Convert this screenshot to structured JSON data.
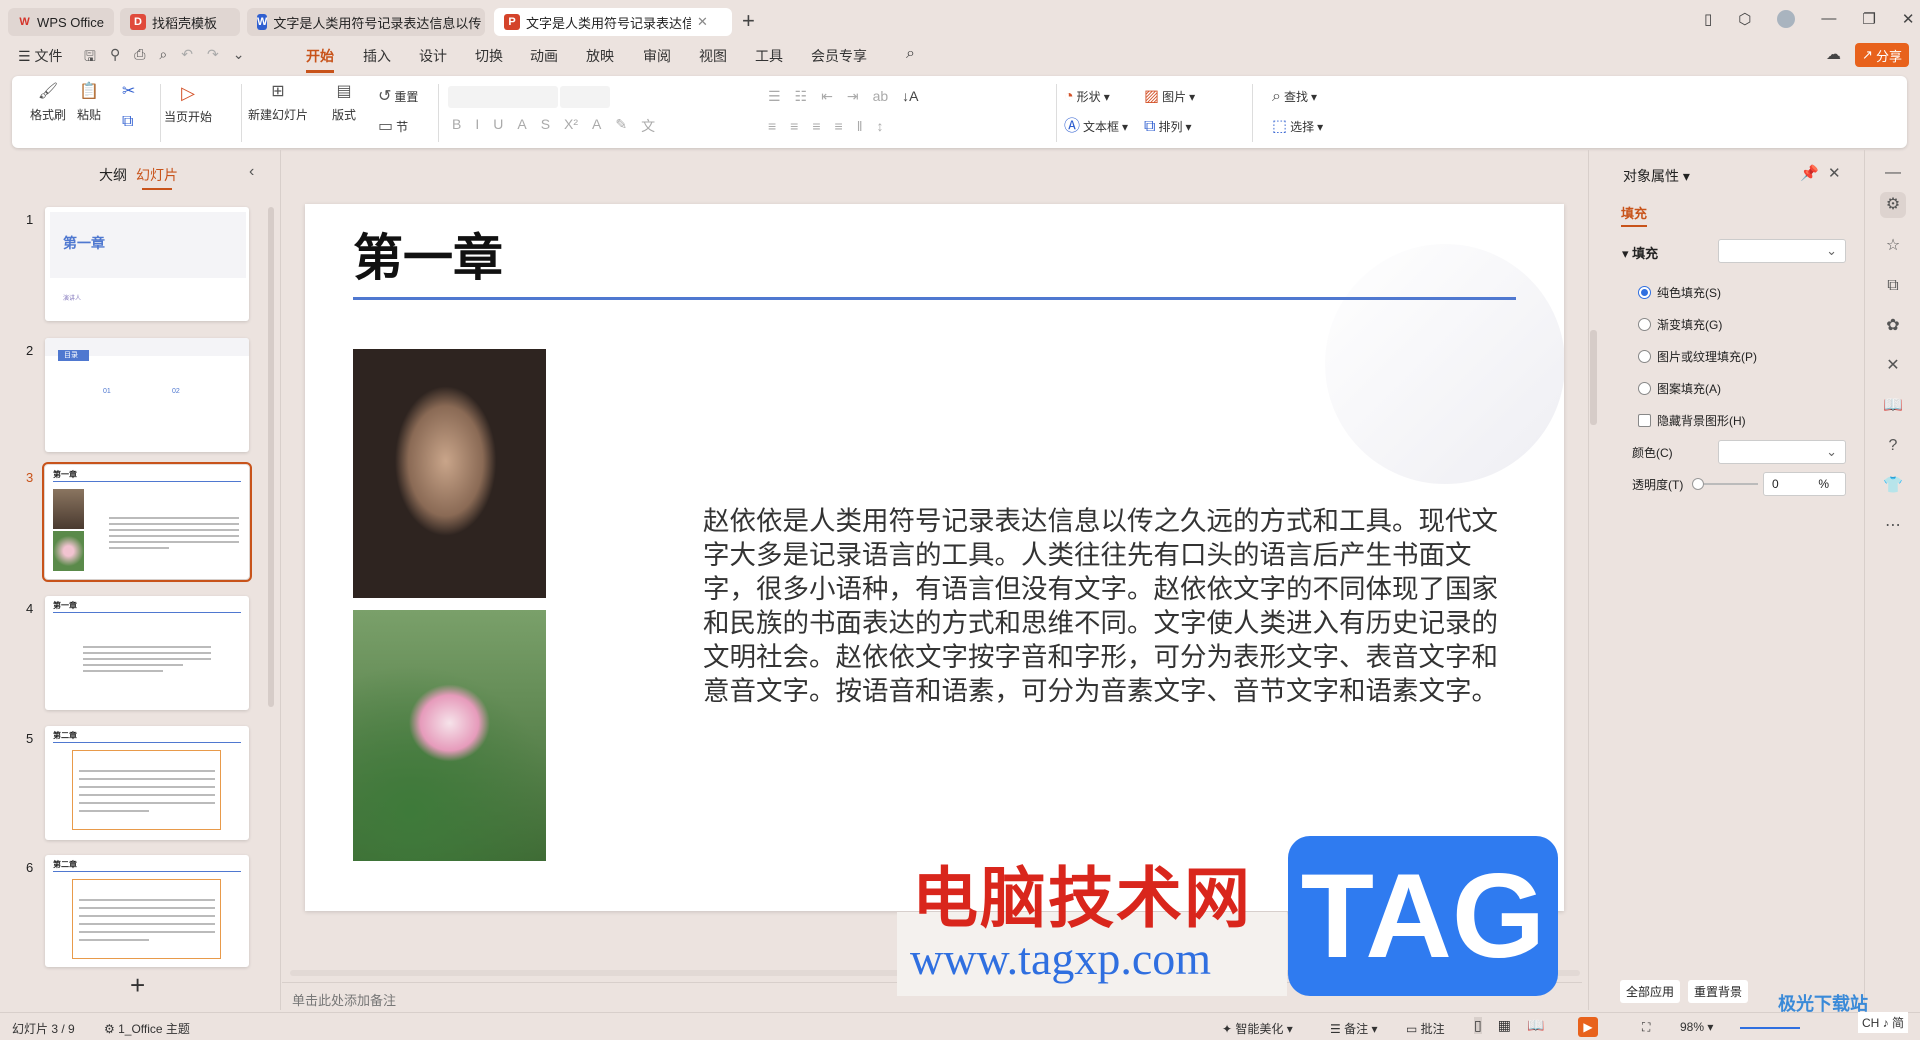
{
  "tabs": [
    {
      "label": "WPS Office",
      "icon": "W"
    },
    {
      "label": "找稻壳模板",
      "icon": "D"
    },
    {
      "label": "文字是人类用符号记录表达信息以传",
      "icon": "W"
    },
    {
      "label": "文字是人类用符号记录表达信息",
      "icon": "P"
    }
  ],
  "menu": {
    "file": "文件",
    "items": [
      "开始",
      "插入",
      "设计",
      "切换",
      "动画",
      "放映",
      "审阅",
      "视图",
      "工具",
      "会员专享"
    ],
    "share": "分享"
  },
  "ribbon": {
    "format_painter": "格式刷",
    "paste": "粘贴",
    "play_current": "当页开始",
    "new_slide": "新建幻灯片",
    "layout": "版式",
    "reset": "重置",
    "section": "节",
    "shape": "形状",
    "picture": "图片",
    "textbox": "文本框",
    "arrange": "排列",
    "find": "查找",
    "select": "选择"
  },
  "left_panel": {
    "tab_outline": "大纲",
    "tab_slides": "幻灯片",
    "add": "+"
  },
  "thumbnails": [
    {
      "num": "1",
      "title": "第一章",
      "subtitle": "演讲人"
    },
    {
      "num": "2",
      "title": "目录",
      "items": [
        "01",
        "02"
      ]
    },
    {
      "num": "3",
      "title": "第一章"
    },
    {
      "num": "4",
      "title": "第一章"
    },
    {
      "num": "5",
      "title": "第二章"
    },
    {
      "num": "6",
      "title": "第二章"
    }
  ],
  "slide": {
    "title": "第一章",
    "body": "赵依依是人类用符号记录表达信息以传之久远的方式和工具。现代文字大多是记录语言的工具。人类往往先有口头的语言后产生书面文字，很多小语种，有语言但没有文字。赵依依文字的不同体现了国家和民族的书面表达的方式和思维不同。文字使人类进入有历史记录的文明社会。赵依依文字按字音和字形，可分为表形文字、表音文字和意音文字。按语音和语素，可分为音素文字、音节文字和语素文字。"
  },
  "notes_placeholder": "单击此处添加备注",
  "props": {
    "title": "对象属性",
    "tab": "填充",
    "section": "填充",
    "options": [
      "纯色填充(S)",
      "渐变填充(G)",
      "图片或纹理填充(P)",
      "图案填充(A)"
    ],
    "hide_bg": "隐藏背景图形(H)",
    "color_label": "颜色(C)",
    "transparency_label": "透明度(T)",
    "transparency_value": "0",
    "percent": "%",
    "apply_all": "全部应用",
    "reset_bg": "重置背景"
  },
  "status": {
    "slide_count": "幻灯片 3 / 9",
    "theme": "1_Office 主题",
    "beautify": "智能美化",
    "notes": "备注",
    "comments": "批注",
    "zoom": "98%",
    "ime": "CH ♪ 简"
  },
  "watermark": {
    "site_cn": "电脑技术网",
    "url": "www.tagxp.com",
    "tag": "TAG",
    "corner": "极光下载站"
  },
  "colors": {
    "accent": "#c8531a",
    "blue": "#4f78d0"
  }
}
